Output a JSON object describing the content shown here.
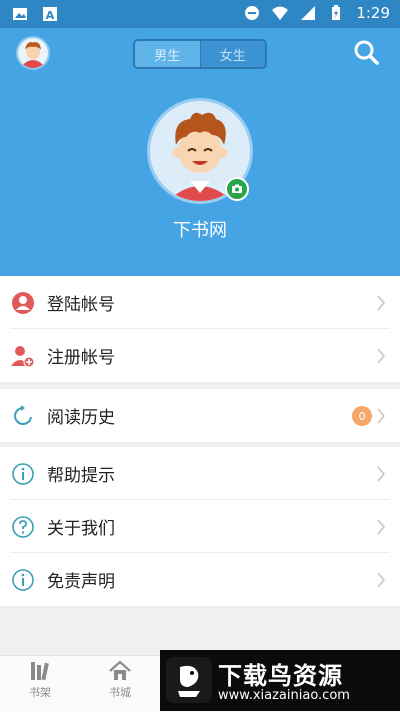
{
  "status_bar": {
    "time": "1:29",
    "icons": [
      "image-icon",
      "text-icon",
      "dnd-icon",
      "wifi-icon",
      "signal-icon",
      "battery-icon"
    ]
  },
  "header": {
    "tabs": [
      {
        "label": "男生",
        "active": true
      },
      {
        "label": "女生",
        "active": false
      }
    ],
    "site_name": "下书网",
    "colors": {
      "background": "#45a4e4",
      "status_bar": "#2f86c4"
    }
  },
  "menu": {
    "group1": [
      {
        "label": "登陆帐号",
        "icon": "user-icon",
        "icon_color": "#e05a5a"
      },
      {
        "label": "注册帐号",
        "icon": "add-user-icon",
        "icon_color": "#e05a5a"
      }
    ],
    "group2": [
      {
        "label": "阅读历史",
        "icon": "refresh-icon",
        "icon_color": "#3aa0b8",
        "badge": "0"
      }
    ],
    "group3": [
      {
        "label": "帮助提示",
        "icon": "info-icon",
        "icon_color": "#3aa0b8"
      },
      {
        "label": "关于我们",
        "icon": "question-icon",
        "icon_color": "#3aa0b8"
      },
      {
        "label": "免责声明",
        "icon": "info-icon",
        "icon_color": "#3aa0b8"
      }
    ]
  },
  "tabbar": {
    "items": [
      {
        "label": "书架",
        "icon": "bookshelf-icon"
      },
      {
        "label": "书城",
        "icon": "home-icon"
      }
    ]
  },
  "watermark": {
    "title": "下载鸟资源",
    "url": "www.xiazainiao.com"
  }
}
